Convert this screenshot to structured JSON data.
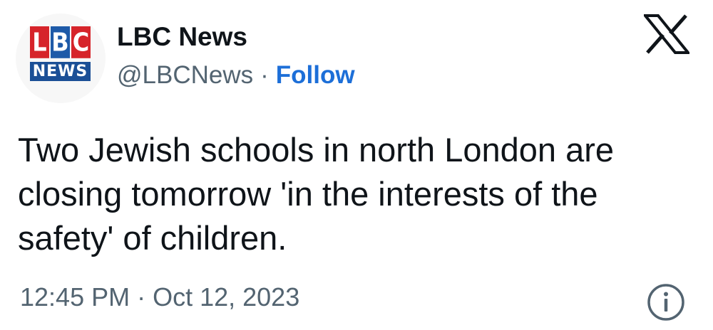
{
  "account": {
    "avatar_logo_top": [
      "L",
      "B",
      "C"
    ],
    "avatar_logo_bottom": "NEWS",
    "display_name": "LBC News",
    "handle": "@LBCNews",
    "separator": "·",
    "follow_label": "Follow"
  },
  "platform_icon": "x-logo-icon",
  "tweet": {
    "text": "Two Jewish schools in north London are closing tomorrow 'in the interests of the safety' of children.",
    "timestamp": "12:45 PM · Oct 12, 2023"
  },
  "info_icon": "info-icon",
  "colors": {
    "text_primary": "#0f1419",
    "text_secondary": "#536471",
    "link": "#1d6fd8",
    "logo_red": "#d6242a",
    "logo_blue": "#1e5aa8",
    "logo_dark_blue": "#1b4f96"
  }
}
